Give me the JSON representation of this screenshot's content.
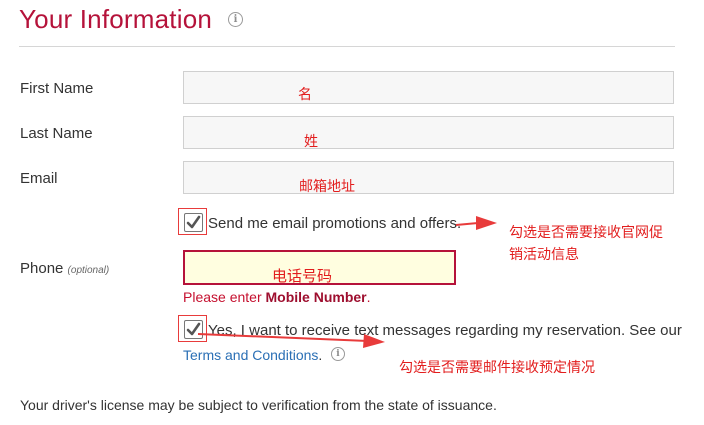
{
  "header": {
    "title": "Your Information",
    "info_icon": "i"
  },
  "form": {
    "first_name_label": "First Name",
    "last_name_label": "Last Name",
    "email_label": "Email",
    "phone_label": "Phone",
    "phone_optional": "(optional)",
    "phone_error_prefix": "Please enter ",
    "phone_error_bold": "Mobile Number",
    "phone_error_suffix": ".",
    "email_promo_label": "Send me email promotions and offers.",
    "email_promo_checked": true,
    "text_opt_label": "Yes, I want to receive text messages regarding my reservation. See our",
    "text_opt_checked": true,
    "terms_link": "Terms and Conditions",
    "terms_period": ".",
    "license_note": "Your driver's license may be subject to verification from the state of issuance."
  },
  "annotations": {
    "first_name": "名",
    "last_name": "姓",
    "email": "邮箱地址",
    "phone": "电话号码",
    "email_promo_line1": "勾选是否需要接收官网促",
    "email_promo_line2": "销活动信息",
    "text_opt": "勾选是否需要邮件接收预定情况"
  },
  "colors": {
    "brand": "#b5123a",
    "annotation": "#e21d1d",
    "link": "#2a6fb5"
  }
}
